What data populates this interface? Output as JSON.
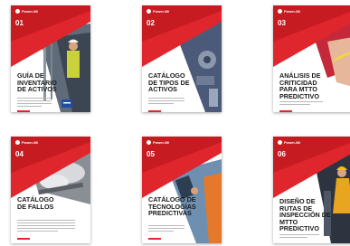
{
  "brand": {
    "logo_text": "Power-MI",
    "accent": "#e0262d",
    "dark_red": "#b3121a"
  },
  "cards": [
    {
      "number": "01",
      "title": "GUÍA DE INVENTARIO DE ACTIVOS",
      "photo": "worker-with-hardhat",
      "badge": "ISO-55000-badge"
    },
    {
      "number": "02",
      "title": "CATÁLOGO DE TIPOS DE ACTIVOS",
      "photo": "industrial-machinery"
    },
    {
      "number": "03",
      "title": "ANÁLISIS DE CRITICIDAD PARA MTTO PREDICTIVO",
      "photo": "hand-with-tool"
    },
    {
      "number": "04",
      "title": "CATÁLOGO DE FALLOS",
      "photo": "steam-pipes"
    },
    {
      "number": "05",
      "title": "CATÁLOGO DE TECNOLOGÍAS PREDICTIVAS",
      "photo": "technician-with-tablet"
    },
    {
      "number": "06",
      "title": "DISEÑO DE RUTAS DE INSPECCIÓN DE MTTO PREDICTIVO",
      "photo": "technician-in-plant"
    }
  ]
}
